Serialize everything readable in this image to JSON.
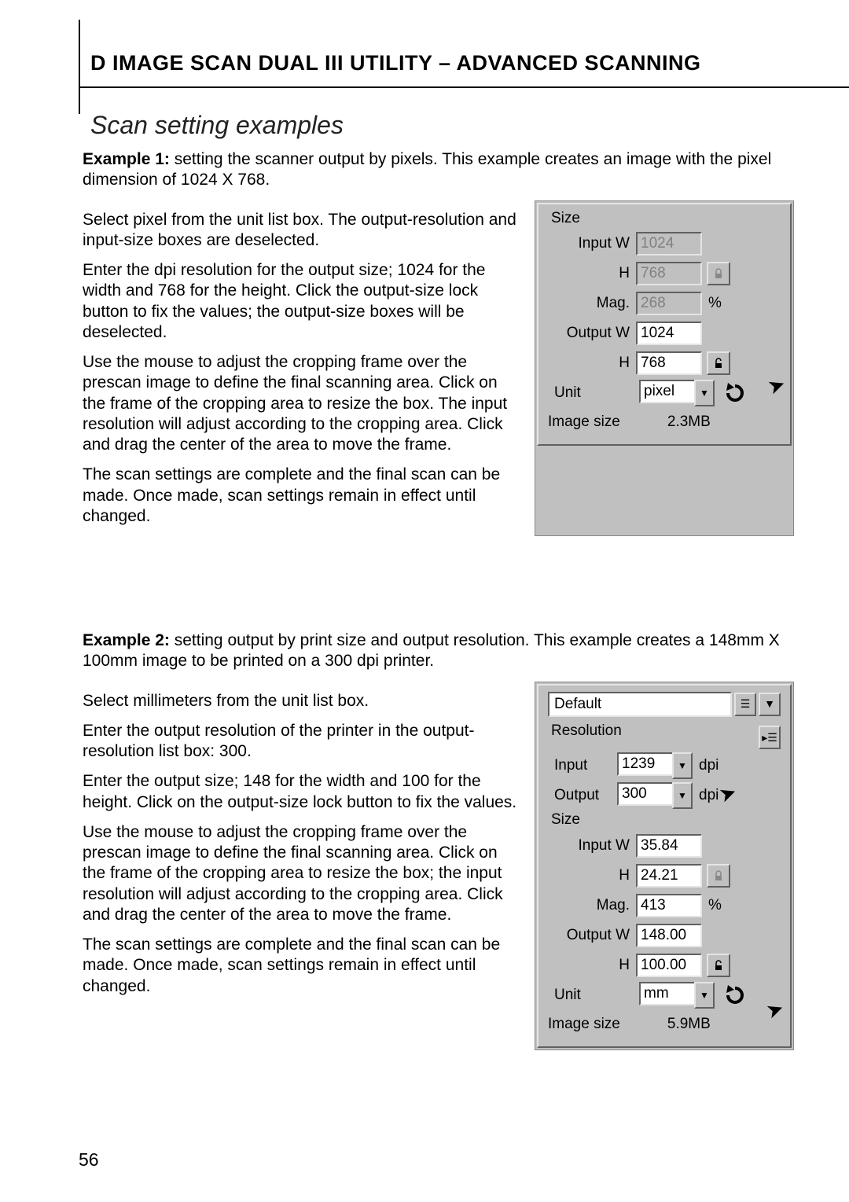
{
  "header": {
    "title_part1": "D",
    "title_part2": "IMAGE SCAN DUAL III UTILITY – ADVANCED SCANNING",
    "section": "Scan setting examples"
  },
  "example1": {
    "label": "Example 1:",
    "intro": " setting the scanner output by pixels. This example creates an image with the pixel dimension of 1024 X 768.",
    "p1": "Select pixel from the unit list box. The output-resolution and input-size boxes are deselected.",
    "p2": "Enter the dpi resolution for the output size; 1024 for the width and 768 for the height. Click the output-size lock button to fix the values; the output-size boxes will be deselected.",
    "p3": "Use the mouse to adjust the cropping frame over the prescan image to define the final scanning area. Click on the frame of the cropping area to resize the box. The input resolution will adjust according to the cropping area. Click and drag the center of the area to move the frame.",
    "p4": "The scan settings are complete and the final scan can be made. Once made, scan settings remain in effect until changed."
  },
  "panel1": {
    "size_label": "Size",
    "input_w_label": "Input W",
    "h_label": "H",
    "mag_label": "Mag.",
    "output_w_label": "Output W",
    "unit_label": "Unit",
    "imagesize_label": "Image size",
    "percent": "%",
    "input_w": "1024",
    "input_h": "768",
    "mag": "268",
    "output_w": "1024",
    "output_h": "768",
    "unit_value": "pixel",
    "imagesize": "2.3MB"
  },
  "example2": {
    "label": "Example 2:",
    "intro": " setting output by print size and output resolution. This example creates a 148mm X 100mm image to be printed on a 300 dpi printer.",
    "p1": "Select millimeters from the unit list box.",
    "p2": "Enter the output resolution of the printer in the output-resolution list box: 300.",
    "p3": "Enter the output size; 148 for the width and 100 for the height. Click on the output-size lock button to fix the values.",
    "p4": "Use the mouse to adjust the cropping frame over the prescan image to define the final scanning area. Click on the frame of the cropping area to resize the box; the input resolution will adjust according to the cropping area. Click and drag the center of the area to move the frame.",
    "p5": "The scan settings are complete and the final scan can be made. Once made, scan settings remain in effect until changed."
  },
  "panel2": {
    "default_label": "Default",
    "resolution_label": "Resolution",
    "input_label": "Input",
    "output_label": "Output",
    "dpi": "dpi",
    "size_label": "Size",
    "input_w_label": "Input W",
    "h_label": "H",
    "mag_label": "Mag.",
    "output_w_label": "Output W",
    "unit_label": "Unit",
    "imagesize_label": "Image size",
    "percent": "%",
    "input_res": "1239",
    "output_res": "300",
    "input_w": "35.84",
    "input_h": "24.21",
    "mag": "413",
    "output_w": "148.00",
    "output_h": "100.00",
    "unit_value": "mm",
    "imagesize": "5.9MB"
  },
  "page_number": "56"
}
